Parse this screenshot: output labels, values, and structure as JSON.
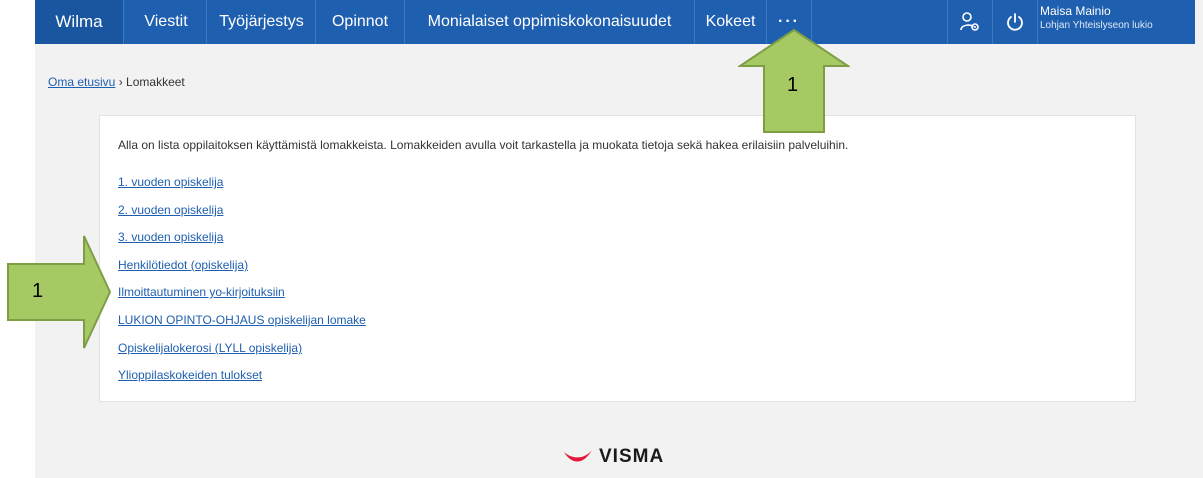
{
  "nav": {
    "brand": "Wilma",
    "items": [
      {
        "label": "Viestit"
      },
      {
        "label": "Työjärjestys"
      },
      {
        "label": "Opinnot"
      },
      {
        "label": "Monialaiset oppimiskokonaisuudet"
      },
      {
        "label": "Kokeet"
      }
    ],
    "more": "···",
    "user_name": "Maisa Mainio",
    "user_school": "Lohjan Yhteislyseon lukio"
  },
  "breadcrumb": {
    "home": "Oma etusivu",
    "separator": "›",
    "current": "Lomakkeet"
  },
  "content": {
    "intro": "Alla on lista oppilaitoksen käyttämistä lomakkeista. Lomakkeiden avulla voit tarkastella ja muokata tietoja sekä hakea erilaisiin palveluihin.",
    "forms": [
      "1. vuoden opiskelija",
      "2. vuoden opiskelija",
      "3. vuoden opiskelija",
      "Henkilötiedot (opiskelija)",
      "Ilmoittautuminen yo-kirjoituksiin",
      "LUKION OPINTO-OHJAUS opiskelijan lomake",
      "Opiskelijalokerosi (LYLL opiskelija)",
      "Ylioppilaskokeiden tulokset"
    ]
  },
  "footer": {
    "logo_text": "VISMA"
  },
  "annotations": {
    "up_arrow_label": "1",
    "right_arrow_label": "1"
  },
  "colors": {
    "nav_bg": "#1f5fb0",
    "link": "#1f5fb0",
    "callout_fill": "#a6c964",
    "visma_red": "#e5183a"
  },
  "icons": {
    "user_settings": "user-gear-icon",
    "logout": "power-icon"
  }
}
